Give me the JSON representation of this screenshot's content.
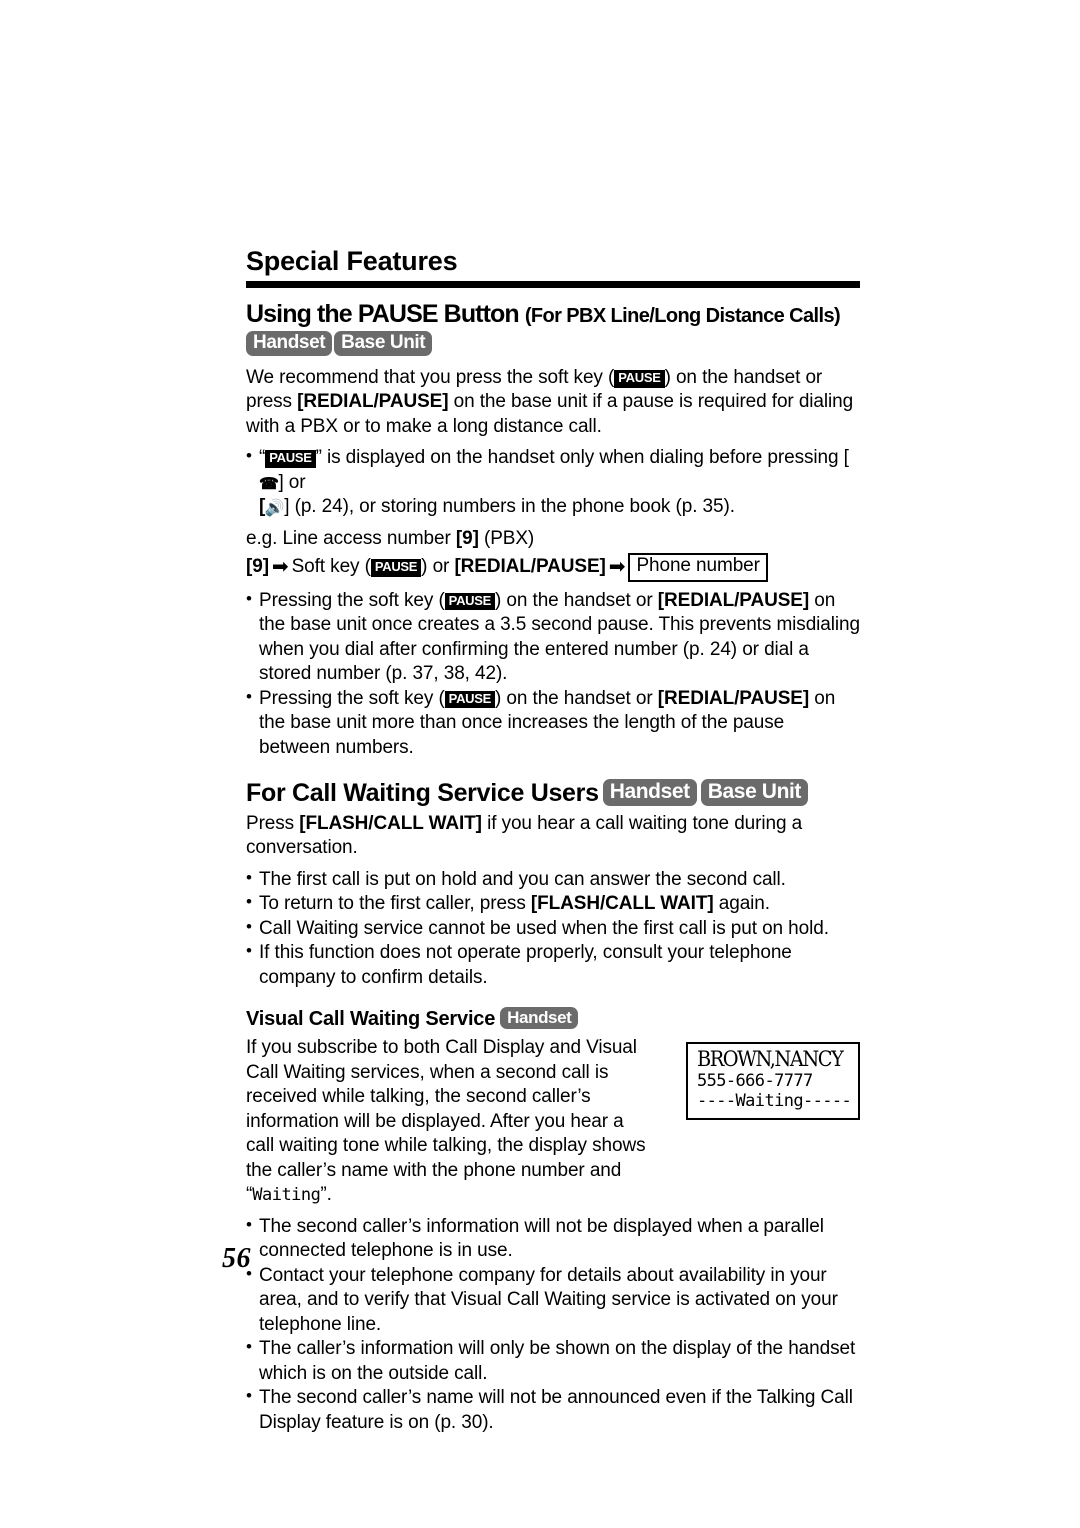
{
  "page": {
    "number": "56",
    "chapter_title": "Special Features"
  },
  "labels": {
    "handset": "Handset",
    "base_unit": "Base Unit",
    "pause_key": "PAUSE",
    "phone_number_box": "Phone number",
    "arrow": "➡",
    "speaker_icon": "🔊",
    "handset_icon": "✆"
  },
  "section_pause": {
    "title_main": "Using the PAUSE Button",
    "title_sub": "(For PBX Line/Long Distance Calls)",
    "intro": {
      "p1": "We recommend that you press the soft key (",
      "p2": ") on the handset or press ",
      "p3": "[REDIAL/PAUSE]",
      "p4": " on the base unit if a pause is required for dialing with a PBX or to make a long distance call."
    },
    "bullet1": {
      "t1": "“",
      "t2": "” is displayed on the handset only when dialing before pressing [",
      "t3": "] or",
      "t4": "] (p. 24), or storing numbers in the phone book (p. 35)."
    },
    "example_label": "e.g. Line access number ",
    "example_key": "[9]",
    "example_suffix": " (PBX)",
    "flow": {
      "step1": "[9]",
      "step2_pre": "Soft key (",
      "step2_post": ") or ",
      "step2_bold": "[REDIAL/PAUSE]",
      "step3": "Phone number"
    },
    "bullet2": {
      "t1": "Pressing the soft key (",
      "t2": ") on the handset or ",
      "t3": "[REDIAL/PAUSE]",
      "t4": " on the base unit once creates a 3.5 second pause. This prevents misdialing when you dial after confirming the entered number (p. 24) or dial a stored number (p. 37, 38, 42)."
    },
    "bullet3": {
      "t1": "Pressing the soft key (",
      "t2": ") on the handset or ",
      "t3": "[REDIAL/PAUSE]",
      "t4": " on the base unit more than once increases the length of the pause between numbers."
    }
  },
  "section_call_waiting": {
    "title": "For Call Waiting Service Users",
    "intro": {
      "t1": "Press ",
      "t2": "[FLASH/CALL WAIT]",
      "t3": " if you hear a call waiting tone during a conversation."
    },
    "bullets": [
      "The first call is put on hold and you can answer the second call.",
      "Call Waiting service cannot be used when the first call is put on hold.",
      "If this function does not operate properly, consult your telephone company to confirm details."
    ],
    "bullet_flash": {
      "t1": "To return to the first caller, press ",
      "t2": "[FLASH/CALL WAIT]",
      "t3": " again."
    }
  },
  "section_visual": {
    "title": "Visual Call Waiting Service",
    "paragraph_1": "If you subscribe to both Call Display and Visual Call Waiting services, when a second call is received while talking, the second caller’s information will be displayed. After you hear a call waiting tone while talking, the display shows the caller’s name with the phone number and ",
    "paragraph_1_quote_open": "“",
    "paragraph_1_quote_word": "Waiting",
    "paragraph_1_quote_close": "”.",
    "lcd_display": {
      "name": "BROWN,NANCY",
      "number": "555-666-7777",
      "status": "----Waiting-----"
    },
    "bullets": [
      "The second caller’s information will not be displayed when a parallel connected telephone is in use.",
      "Contact your telephone company for details about availability in your area, and to verify that Visual Call Waiting service is activated on your telephone line.",
      "The caller’s information will only be shown on the display of the handset which is on the outside call.",
      "The second caller’s name will not be announced even if the Talking Call Display feature is on (p. 30)."
    ]
  },
  "colors": {
    "badge_gray": "#6b6b6b",
    "softkey_black": "#000000",
    "text": "#000000",
    "background": "#ffffff"
  }
}
